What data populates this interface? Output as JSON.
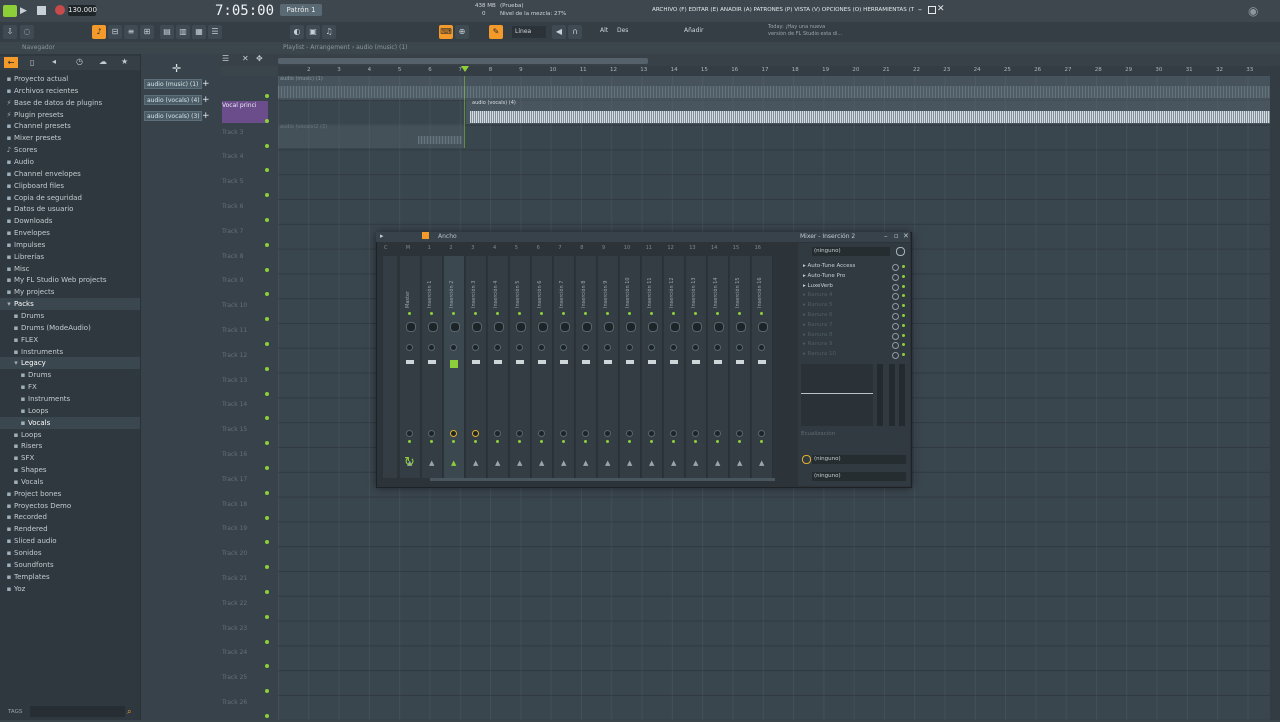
{
  "topbar": {
    "tempo": "130.000",
    "time": "7:05:00",
    "pattern": "Patrón 1",
    "cpu_mb": "438 MB",
    "cpu_num": "0",
    "hint_title": "(Prueba)",
    "hint_text": "Nivel de la mezcla: 27%",
    "menu": "ARCHIVO (F) EDITAR (E) AÑADIR (A) PATRONES (P) VISTA (V) OPCIONES (O) HERRAMIENTAS (T) AYUDA",
    "news_line1": "Today: ¡Hay una nueva",
    "news_line2": "versión de FL Studio esta di..."
  },
  "toolbar": {
    "snap_label": "Línea",
    "add_label": "Añadir",
    "alt_label": "Alt",
    "des_label": "Des"
  },
  "browser": {
    "title": "Navegador",
    "items": [
      {
        "label": "Proyecto actual",
        "icon": "folder-icon",
        "selected": false
      },
      {
        "label": "Archivos recientes",
        "icon": "folder-icon",
        "selected": false
      },
      {
        "label": "Base de datos de plugins",
        "icon": "plug-icon",
        "selected": false
      },
      {
        "label": "Plugin presets",
        "icon": "plug-icon",
        "selected": false
      },
      {
        "label": "Channel presets",
        "icon": "preset-icon",
        "selected": false
      },
      {
        "label": "Mixer presets",
        "icon": "preset-icon",
        "selected": false
      },
      {
        "label": "Scores",
        "icon": "note-icon",
        "selected": false
      },
      {
        "label": "Audio",
        "icon": "folder-icon",
        "selected": false
      },
      {
        "label": "Channel envelopes",
        "icon": "folder-icon",
        "selected": false
      },
      {
        "label": "Clipboard files",
        "icon": "folder-icon",
        "selected": false
      },
      {
        "label": "Copia de seguridad",
        "icon": "folder-icon",
        "selected": false
      },
      {
        "label": "Datos de usuario",
        "icon": "folder-icon",
        "selected": false
      },
      {
        "label": "Downloads",
        "icon": "folder-icon",
        "selected": false
      },
      {
        "label": "Envelopes",
        "icon": "folder-icon",
        "selected": false
      },
      {
        "label": "Impulses",
        "icon": "folder-icon",
        "selected": false
      },
      {
        "label": "Librerías",
        "icon": "folder-icon",
        "selected": false
      },
      {
        "label": "Misc",
        "icon": "folder-icon",
        "selected": false
      },
      {
        "label": "My FL Studio Web projects",
        "icon": "folder-icon",
        "selected": false
      },
      {
        "label": "My projects",
        "icon": "folder-icon",
        "selected": false
      },
      {
        "label": "Packs",
        "icon": "folder-open-icon",
        "selected": true
      },
      {
        "label": "Drums",
        "icon": "folder-icon",
        "selected": false,
        "indent": 1
      },
      {
        "label": "Drums (ModeAudio)",
        "icon": "folder-icon",
        "selected": false,
        "indent": 1
      },
      {
        "label": "FLEX",
        "icon": "folder-icon",
        "selected": false,
        "indent": 1
      },
      {
        "label": "Instruments",
        "icon": "folder-icon",
        "selected": false,
        "indent": 1
      },
      {
        "label": "Legacy",
        "icon": "folder-open-icon",
        "selected": true,
        "indent": 1
      },
      {
        "label": "Drums",
        "icon": "folder-icon",
        "selected": false,
        "indent": 2
      },
      {
        "label": "FX",
        "icon": "folder-icon",
        "selected": false,
        "indent": 2
      },
      {
        "label": "Instruments",
        "icon": "folder-icon",
        "selected": false,
        "indent": 2
      },
      {
        "label": "Loops",
        "icon": "folder-icon",
        "selected": false,
        "indent": 2
      },
      {
        "label": "Vocals",
        "icon": "folder-icon",
        "selected": true,
        "indent": 2
      },
      {
        "label": "Loops",
        "icon": "folder-icon",
        "selected": false,
        "indent": 1
      },
      {
        "label": "Risers",
        "icon": "folder-icon",
        "selected": false,
        "indent": 1
      },
      {
        "label": "SFX",
        "icon": "folder-icon",
        "selected": false,
        "indent": 1
      },
      {
        "label": "Shapes",
        "icon": "folder-icon",
        "selected": false,
        "indent": 1
      },
      {
        "label": "Vocals",
        "icon": "folder-icon",
        "selected": false,
        "indent": 1
      },
      {
        "label": "Project bones",
        "icon": "folder-icon",
        "selected": false
      },
      {
        "label": "Proyectos Demo",
        "icon": "folder-icon",
        "selected": false
      },
      {
        "label": "Recorded",
        "icon": "folder-icon",
        "selected": false
      },
      {
        "label": "Rendered",
        "icon": "folder-icon",
        "selected": false
      },
      {
        "label": "Sliced audio",
        "icon": "folder-icon",
        "selected": false
      },
      {
        "label": "Sonidos",
        "icon": "folder-icon",
        "selected": false
      },
      {
        "label": "Soundfonts",
        "icon": "folder-icon",
        "selected": false
      },
      {
        "label": "Templates",
        "icon": "folder-icon",
        "selected": false
      },
      {
        "label": "Yoz",
        "icon": "folder-icon",
        "selected": false
      }
    ],
    "tags_label": "TAGS"
  },
  "channels": [
    {
      "label": "audio (music) (1)"
    },
    {
      "label": "audio (vocals) (4)"
    },
    {
      "label": "audio (vocals) (3)"
    }
  ],
  "playlist": {
    "title": "Playlist - Arrangement › audio (music) (1)",
    "ruler": [
      "2",
      "3",
      "4",
      "5",
      "6",
      "7",
      "8",
      "9",
      "10",
      "11",
      "12",
      "13",
      "14",
      "15",
      "16",
      "17",
      "18",
      "19",
      "20",
      "21",
      "22",
      "23",
      "24",
      "25",
      "26",
      "27",
      "28",
      "29",
      "30",
      "31",
      "32",
      "33"
    ],
    "tracks": [
      {
        "label": "",
        "clip": "audio (music) (1)"
      },
      {
        "label": "Vocal princi",
        "clip": "audio (vocals) (4)"
      },
      {
        "label": "Track 3",
        "clip": "audio (vocals)2 (3)"
      },
      {
        "label": "Track 4"
      },
      {
        "label": "Track 5"
      },
      {
        "label": "Track 6"
      },
      {
        "label": "Track 7"
      },
      {
        "label": "Track 8"
      },
      {
        "label": "Track 9"
      },
      {
        "label": "Track 10"
      },
      {
        "label": "Track 11"
      },
      {
        "label": "Track 12"
      },
      {
        "label": "Track 13"
      },
      {
        "label": "Track 14"
      },
      {
        "label": "Track 15"
      },
      {
        "label": "Track 16"
      },
      {
        "label": "Track 17"
      },
      {
        "label": "Track 18"
      },
      {
        "label": "Track 19"
      },
      {
        "label": "Track 20"
      },
      {
        "label": "Track 21"
      },
      {
        "label": "Track 22"
      },
      {
        "label": "Track 23"
      },
      {
        "label": "Track 24"
      },
      {
        "label": "Track 25"
      },
      {
        "label": "Track 26"
      }
    ]
  },
  "mixer": {
    "title": "Ancho",
    "strips": [
      "Master",
      "Inserción 1",
      "Inserción 2",
      "Inserción 3",
      "Inserción 4",
      "Inserción 5",
      "Inserción 6",
      "Inserción 7",
      "Inserción 8",
      "Inserción 9",
      "Inserción 10",
      "Inserción 11",
      "Inserción 12",
      "Inserción 13",
      "Inserción 14",
      "Inserción 15",
      "Inserción 16"
    ],
    "numbers": [
      "C",
      "M",
      "1",
      "2",
      "3",
      "4",
      "5",
      "6",
      "7",
      "8",
      "9",
      "10",
      "11",
      "12",
      "13",
      "14",
      "15",
      "16"
    ]
  },
  "insert": {
    "title": "Mixer - Inserción 2",
    "input": "(ninguno)",
    "slots": [
      {
        "label": "Auto-Tune Access",
        "active": true
      },
      {
        "label": "Auto-Tune Pro",
        "active": true
      },
      {
        "label": "LuxeVerb",
        "active": true
      },
      {
        "label": "Ranura 4",
        "active": false
      },
      {
        "label": "Ranura 5",
        "active": false
      },
      {
        "label": "Ranura 6",
        "active": false
      },
      {
        "label": "Ranura 7",
        "active": false
      },
      {
        "label": "Ranura 8",
        "active": false
      },
      {
        "label": "Ranura 9",
        "active": false
      },
      {
        "label": "Ranura 10",
        "active": false
      }
    ],
    "eq_label": "Ecualización",
    "output": "(ninguno)",
    "output2": "(ninguno)"
  }
}
